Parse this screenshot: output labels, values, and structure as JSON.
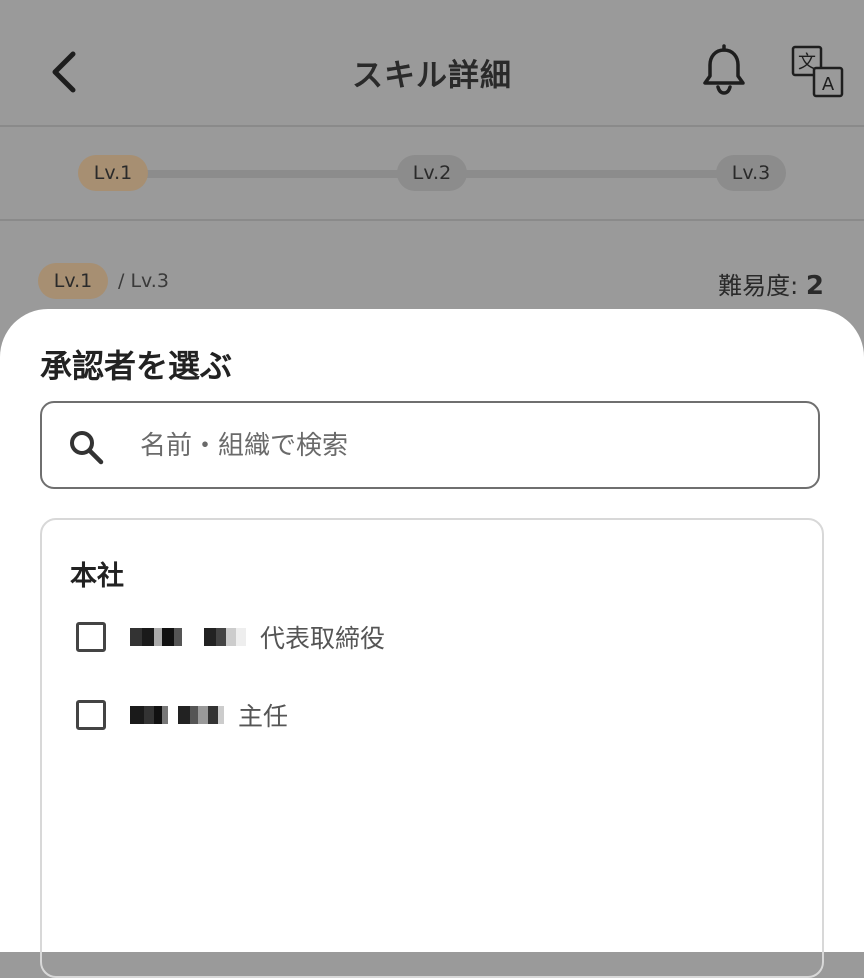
{
  "header": {
    "title": "スキル詳細"
  },
  "levels": {
    "items": [
      {
        "label": "Lv.1",
        "active": true
      },
      {
        "label": "Lv.2",
        "active": false
      },
      {
        "label": "Lv.3",
        "active": false
      }
    ],
    "current": "Lv.1",
    "max": "/ Lv.3",
    "difficulty_label": "難易度:",
    "difficulty_value": "2"
  },
  "sheet": {
    "title": "承認者を選ぶ",
    "search": {
      "placeholder": "名前・組織で検索",
      "value": ""
    },
    "groups": [
      {
        "name": "本社",
        "people": [
          {
            "role": "代表取締役",
            "checked": false
          },
          {
            "role": "主任",
            "checked": false
          }
        ]
      }
    ]
  },
  "colors": {
    "accent": "#a78f72",
    "overlay": "#9a9a9a",
    "sheet": "#ffffff"
  },
  "icons": {
    "back": "chevron-left-icon",
    "notifications": "bell-icon",
    "translate": "translate-icon",
    "search": "search-icon"
  }
}
